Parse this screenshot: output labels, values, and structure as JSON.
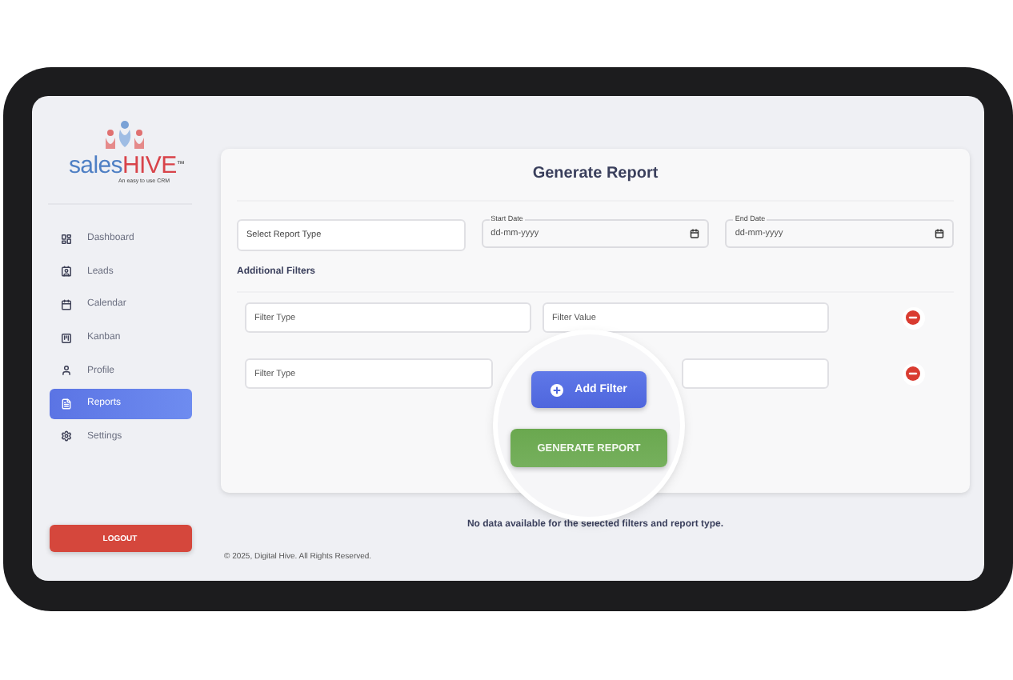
{
  "logo": {
    "name_first": "sales",
    "name_second": "HIVE",
    "trademark": "™",
    "tagline": "An easy to use CRM"
  },
  "sidebar": {
    "items": [
      {
        "label": "Dashboard",
        "selected": false
      },
      {
        "label": "Leads",
        "selected": false
      },
      {
        "label": "Calendar",
        "selected": false
      },
      {
        "label": "Kanban",
        "selected": false
      },
      {
        "label": "Profile",
        "selected": false
      },
      {
        "label": "Reports",
        "selected": true
      },
      {
        "label": "Settings",
        "selected": false
      }
    ],
    "logout": "LOGOUT"
  },
  "report": {
    "title": "Generate Report",
    "report_type": {
      "placeholder": "Select Report Type"
    },
    "start_date": {
      "label": "Start Date",
      "value": "dd-mm-yyyy"
    },
    "end_date": {
      "label": "End Date",
      "value": "dd-mm-yyyy"
    },
    "additional_filters": "Additional Filters",
    "filters": [
      {
        "type_placeholder": "Filter Type",
        "value_placeholder": "Filter Value"
      },
      {
        "type_placeholder": "Filter Type"
      }
    ],
    "add_filter": "Add Filter",
    "generate": "GENERATE REPORT"
  },
  "message": "No data available for the selected filters and report type.",
  "footer": "© 2025, Digital Hive. All Rights Reserved."
}
